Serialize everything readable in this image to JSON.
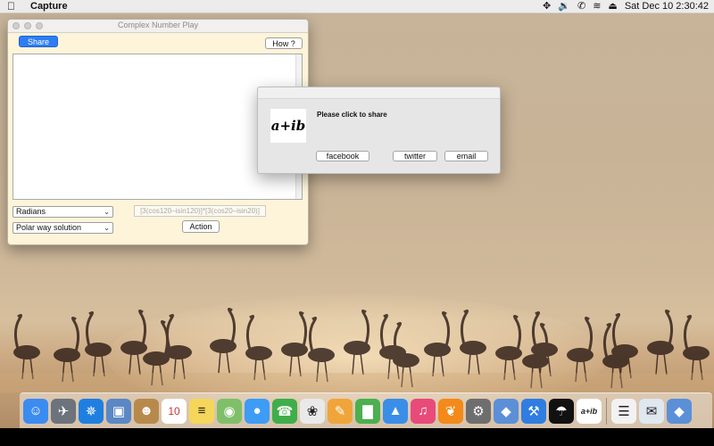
{
  "menubar": {
    "apple_icon": "apple-icon",
    "app_name": "Capture",
    "status_icons": [
      "move-arrows-icon",
      "speaker-icon",
      "phone-icon",
      "wifi-icon",
      "eject-icon"
    ],
    "clock": "Sat Dec 10  2:30:42"
  },
  "window": {
    "title": "Complex Number Play",
    "share_label": "Share",
    "how_label": "How ?",
    "angle_select": "Radians",
    "method_select": "Polar way solution",
    "expression_placeholder": "[3(cos120–isin120)]*[3(cos20–isin20)]",
    "action_label": "Action"
  },
  "share_popup": {
    "logo_text": "a+ib",
    "message": "Please click to share",
    "buttons": [
      "facebook",
      "twitter",
      "email"
    ]
  },
  "dock": {
    "items": [
      {
        "name": "finder",
        "glyph": "☺",
        "color": "#3b8cf0",
        "running": true
      },
      {
        "name": "launchpad",
        "glyph": "✈",
        "color": "#6c737c",
        "running": false
      },
      {
        "name": "safari",
        "glyph": "✵",
        "color": "#1f7fe0",
        "running": true
      },
      {
        "name": "preview",
        "glyph": "▣",
        "color": "#5b87c5",
        "running": false
      },
      {
        "name": "contacts",
        "glyph": "☻",
        "color": "#b78a4c",
        "running": false
      },
      {
        "name": "calendar",
        "glyph": "10",
        "color": "#ffffff",
        "running": false
      },
      {
        "name": "notes",
        "glyph": "≡",
        "color": "#f5d65a",
        "running": false
      },
      {
        "name": "maps",
        "glyph": "◉",
        "color": "#7fbf6a",
        "running": false
      },
      {
        "name": "messages",
        "glyph": "●",
        "color": "#3d9cf5",
        "running": false
      },
      {
        "name": "facetime",
        "glyph": "☎",
        "color": "#3fae4a",
        "running": false
      },
      {
        "name": "photos",
        "glyph": "❀",
        "color": "#e9e9e9",
        "running": false
      },
      {
        "name": "pages",
        "glyph": "✎",
        "color": "#f0a53a",
        "running": false
      },
      {
        "name": "numbers",
        "glyph": "▇",
        "color": "#4caf50",
        "running": false
      },
      {
        "name": "keynote",
        "glyph": "▲",
        "color": "#3a8ee8",
        "running": false
      },
      {
        "name": "itunes",
        "glyph": "♫",
        "color": "#e84a7a",
        "running": false
      },
      {
        "name": "ibooks",
        "glyph": "❦",
        "color": "#f38a1a",
        "running": false
      },
      {
        "name": "system-preferences",
        "glyph": "⚙",
        "color": "#6e6e6e",
        "running": false
      },
      {
        "name": "virtualbox",
        "glyph": "◆",
        "color": "#5b8fd8",
        "running": true
      },
      {
        "name": "xcode",
        "glyph": "⚒",
        "color": "#2f7de1",
        "running": true
      },
      {
        "name": "tooth-app",
        "glyph": "☂",
        "color": "#111111",
        "running": false
      },
      {
        "name": "complex-number-play",
        "glyph": "a+ib",
        "color": "#ffffff",
        "running": true
      },
      {
        "name": "documents",
        "glyph": "☰",
        "color": "#f2f2f2",
        "running": false
      },
      {
        "name": "downloads",
        "glyph": "✉",
        "color": "#dfe7ef",
        "running": false
      },
      {
        "name": "virtualbox-2",
        "glyph": "◆",
        "color": "#5b8fd8",
        "running": false
      }
    ]
  }
}
